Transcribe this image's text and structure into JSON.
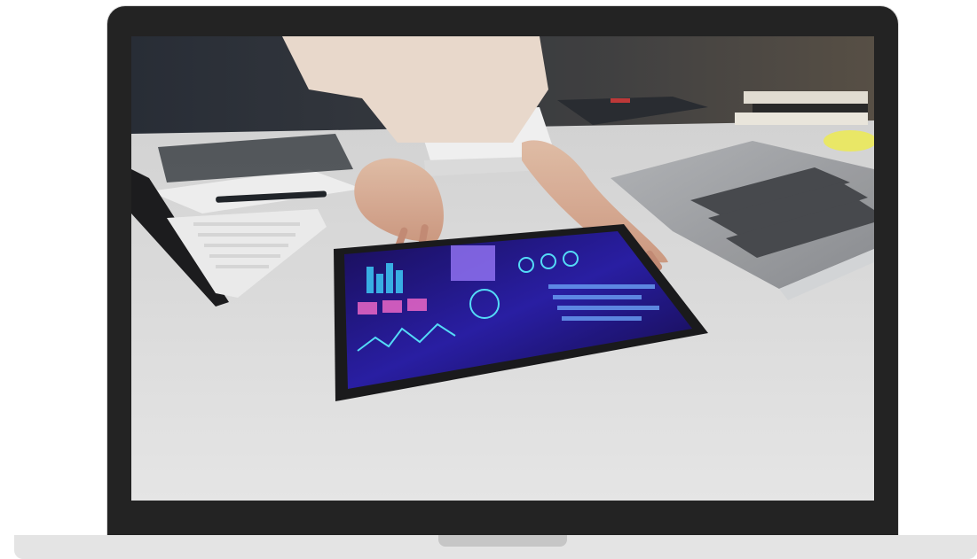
{
  "image": {
    "subject": "laptop-mockup",
    "screen_content": "desk-tablet-analytics-photo",
    "colors": {
      "bezel": "#232323",
      "base": "#e4e4e4",
      "notch": "#c6c6c6",
      "desk": "#e6e6e6",
      "tablet_glow": "#3b2fd1"
    },
    "icons": [
      "laptop-icon",
      "tablet-icon",
      "keyboard-icon",
      "calculator-icon",
      "pen-icon"
    ]
  }
}
